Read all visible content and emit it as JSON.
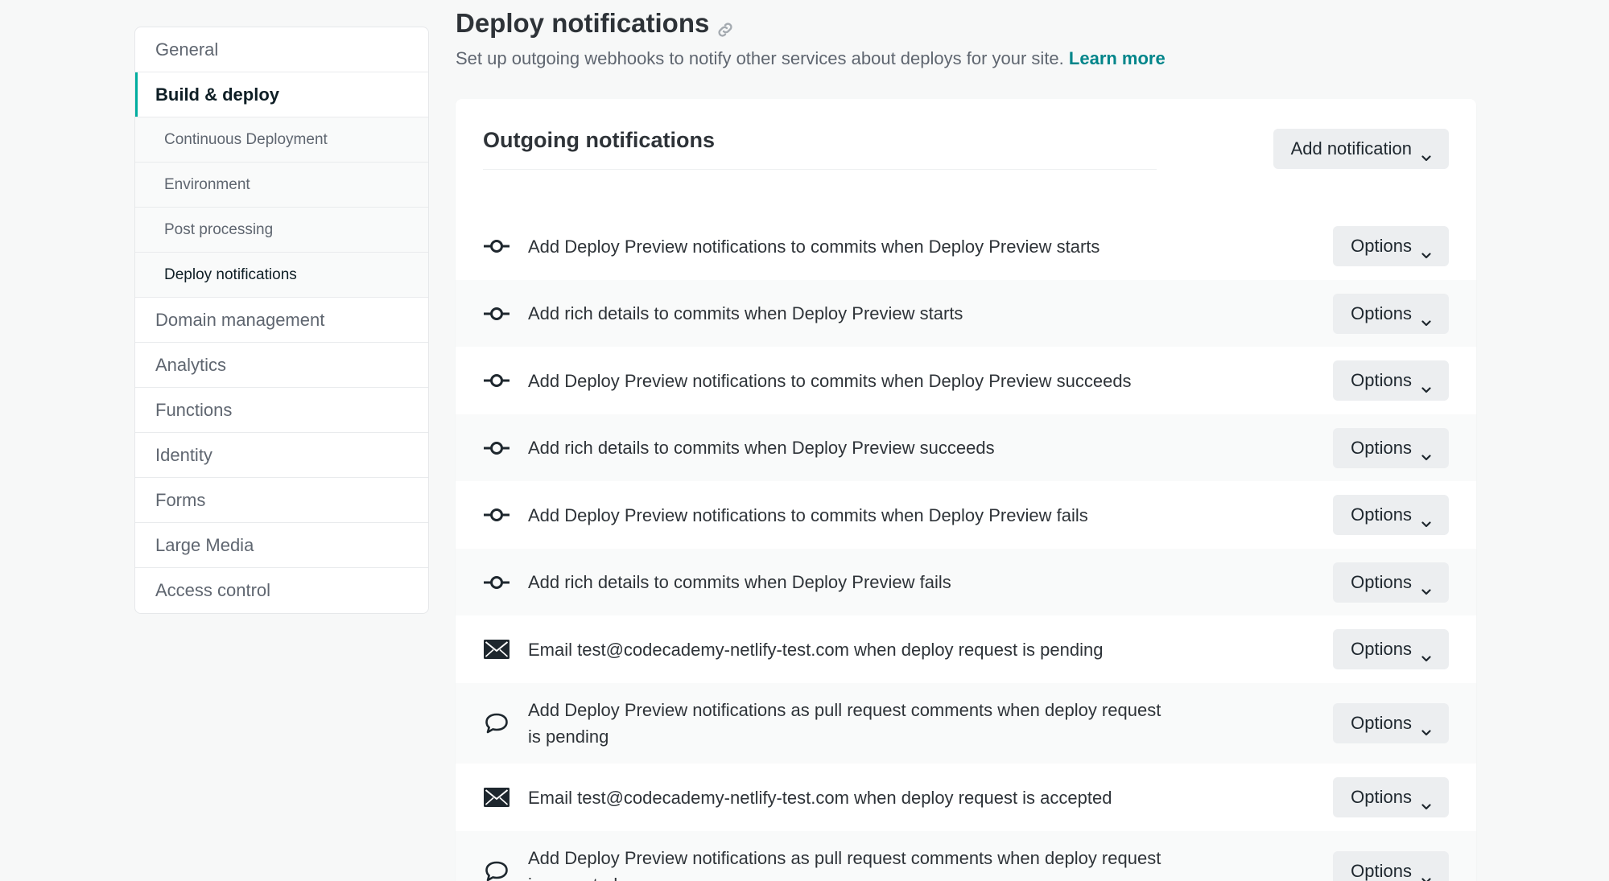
{
  "sidebar": {
    "items": [
      {
        "label": "General"
      },
      {
        "label": "Build & deploy"
      },
      {
        "label": "Domain management"
      },
      {
        "label": "Analytics"
      },
      {
        "label": "Functions"
      },
      {
        "label": "Identity"
      },
      {
        "label": "Forms"
      },
      {
        "label": "Large Media"
      },
      {
        "label": "Access control"
      }
    ],
    "subitems": [
      {
        "label": "Continuous Deployment"
      },
      {
        "label": "Environment"
      },
      {
        "label": "Post processing"
      },
      {
        "label": "Deploy notifications"
      }
    ]
  },
  "header": {
    "title": "Deploy notifications",
    "title_icon": "link-icon",
    "subtitle": "Set up outgoing webhooks to notify other services about deploys for your site.",
    "learn_more": "Learn more"
  },
  "card": {
    "title": "Outgoing notifications",
    "add_button": "Add notification",
    "options_label": "Options",
    "rows": [
      {
        "icon": "commit-icon",
        "text": "Add Deploy Preview notifications to commits when Deploy Preview starts"
      },
      {
        "icon": "commit-icon",
        "text": "Add rich details to commits when Deploy Preview starts"
      },
      {
        "icon": "commit-icon",
        "text": "Add Deploy Preview notifications to commits when Deploy Preview succeeds"
      },
      {
        "icon": "commit-icon",
        "text": "Add rich details to commits when Deploy Preview succeeds"
      },
      {
        "icon": "commit-icon",
        "text": "Add Deploy Preview notifications to commits when Deploy Preview fails"
      },
      {
        "icon": "commit-icon",
        "text": "Add rich details to commits when Deploy Preview fails"
      },
      {
        "icon": "email-icon",
        "text": "Email test@codecademy-netlify-test.com when deploy request is pending"
      },
      {
        "icon": "comment-icon",
        "text": "Add Deploy Preview notifications as pull request comments when deploy request is pending"
      },
      {
        "icon": "email-icon",
        "text": "Email test@codecademy-netlify-test.com when deploy request is accepted"
      },
      {
        "icon": "comment-icon",
        "text": "Add Deploy Preview notifications as pull request comments when deploy request is accepted"
      }
    ]
  },
  "colors": {
    "accent": "#00ad9f",
    "link": "#00858a"
  }
}
